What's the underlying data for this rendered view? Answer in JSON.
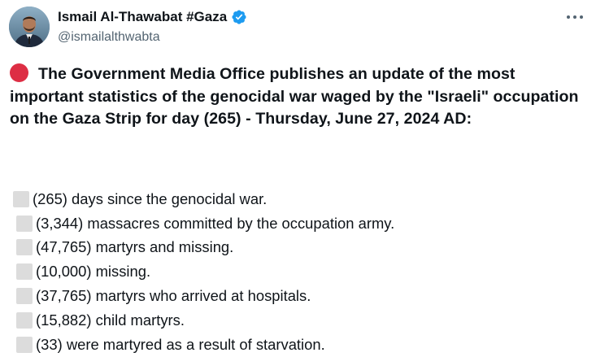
{
  "author": {
    "name": "Ismail Al-Thawabat #Gaza",
    "handle": "@ismailalthwabta",
    "verified_color": "#1d9bf0",
    "avatar_icon": "profile-photo"
  },
  "more_icon": "ellipsis-icon",
  "tweet": {
    "headline_icon": "red-circle",
    "headline_icon_color": "#dd2e44",
    "headline": "The Government Media Office publishes an update of the most important statistics of the genocidal war waged by the \"Israeli\" occupation on the Gaza Strip for day (265) - Thursday, June 27, 2024 AD:",
    "stats": [
      "(265) days since the genocidal war.",
      "(3,344) massacres committed by the occupation army.",
      "(47,765) martyrs and missing.",
      "(10,000) missing.",
      "(37,765) martyrs who arrived at hospitals.",
      "(15,882) child martyrs.",
      "(33) were martyred as a result of starvation."
    ],
    "stat_bullet_icon": "placeholder-box-icon"
  }
}
